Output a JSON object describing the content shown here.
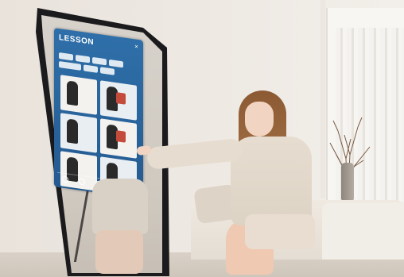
{
  "mirror_ui": {
    "title": "LESSON",
    "subtitle": "",
    "close_icon": "close-icon",
    "filters": [
      "",
      "",
      "",
      "",
      "",
      "",
      ""
    ],
    "tiles": [
      {
        "name": "workout-tile-1"
      },
      {
        "name": "workout-tile-2"
      },
      {
        "name": "workout-tile-3"
      },
      {
        "name": "workout-tile-4"
      },
      {
        "name": "workout-tile-5"
      },
      {
        "name": "workout-tile-6"
      }
    ],
    "nav_icons": [
      "home-icon",
      "lesson-icon",
      "profile-icon",
      "stats-icon",
      "settings-icon"
    ]
  },
  "colors": {
    "panel_blue": "#2f6fa9",
    "wall": "#ece7e1",
    "sweater": "#e6ddd0",
    "hair": "#9c6a40"
  }
}
